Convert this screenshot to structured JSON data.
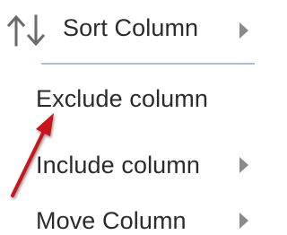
{
  "menu": {
    "items": [
      {
        "label": "Sort Column",
        "icon": "sort-icon",
        "has_submenu": true
      },
      {
        "label": "Exclude column",
        "has_submenu": false
      },
      {
        "label": "Include column",
        "has_submenu": true
      },
      {
        "label": "Move Column",
        "has_submenu": true
      }
    ]
  },
  "colors": {
    "text": "#2b2b2b",
    "icon": "#6a6a6a",
    "submenu_arrow": "#8a8a8a",
    "separator": "#a9bedc",
    "annotation_arrow": "#c8141e"
  }
}
